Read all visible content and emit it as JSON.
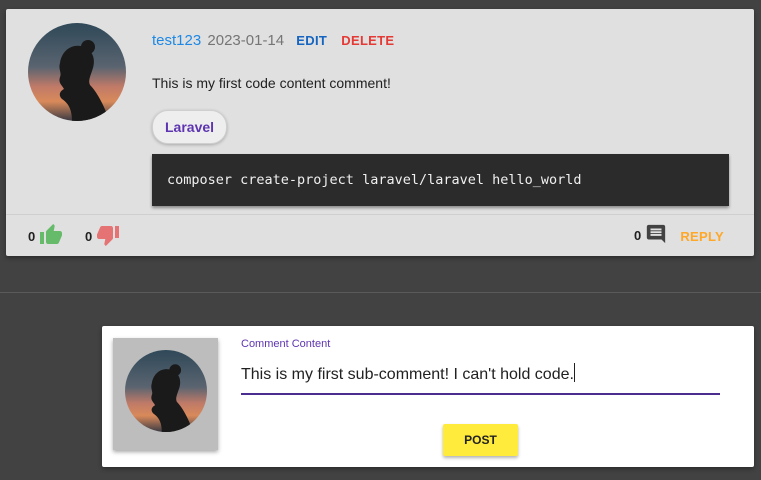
{
  "comment": {
    "username": "test123",
    "date": "2023-01-14",
    "edit_label": "EDIT",
    "delete_label": "DELETE",
    "content": "This is my first code content comment!",
    "tag": "Laravel",
    "code": "composer create-project laravel/laravel hello_world",
    "likes": "0",
    "dislikes": "0",
    "replies": "0",
    "reply_label": "REPLY"
  },
  "sub_comment_form": {
    "field_label": "Comment Content",
    "field_value": "This is my first sub-comment! I can't hold code.",
    "post_label": "POST"
  },
  "colors": {
    "page_background": "#424242",
    "like": "#66bb6a",
    "dislike": "#e57373",
    "reply": "#ffa726",
    "edit": "#1565c0",
    "delete": "#e53935",
    "post_button": "#ffeb3b",
    "accent": "#5e35b1"
  },
  "icons": {
    "like": "thumb-up-icon",
    "dislike": "thumb-down-icon",
    "replies": "comment-icon"
  }
}
